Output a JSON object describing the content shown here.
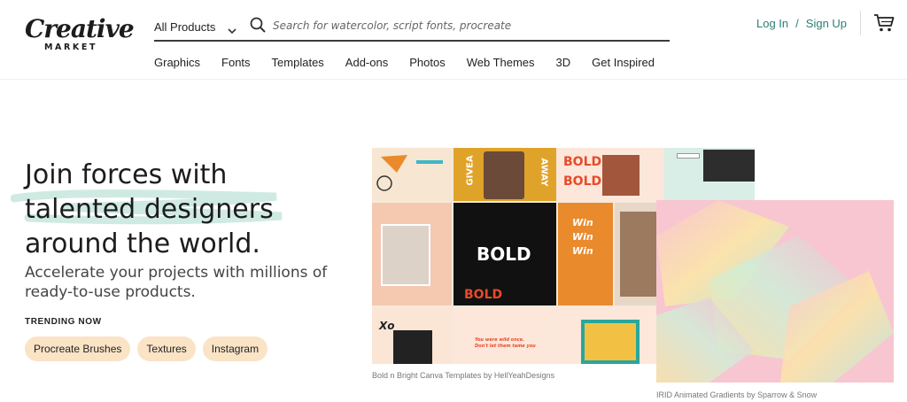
{
  "header": {
    "logo_word": "Creative",
    "logo_sub": "MARKET",
    "product_select": "All Products",
    "search_placeholder": "Search for watercolor, script fonts, procreate",
    "login": "Log In",
    "separator": "/",
    "signup": "Sign Up",
    "nav": [
      "Graphics",
      "Fonts",
      "Templates",
      "Add-ons",
      "Photos",
      "Web Themes",
      "3D",
      "Get Inspired"
    ]
  },
  "hero": {
    "title": "Join forces with talented designers around the world.",
    "subtitle": "Accelerate your projects with millions of ready-to-use products.",
    "trending_label": "TRENDING NOW",
    "trending": [
      "Procreate Brushes",
      "Textures",
      "Instagram"
    ]
  },
  "collage": {
    "caption_left": "Bold n Bright Canva Templates by HellYeahDesigns",
    "caption_right": "IRID Animated Gradients by Sparrow & Snow",
    "tile_words": {
      "giveaway_left": "GIVEA",
      "giveaway_right": "AWAY",
      "bold": "BOLD",
      "win": "Win",
      "xo": "Xo",
      "wild": "You were wild once. Don't let them tame you"
    }
  },
  "colors": {
    "accent_teal": "#2a7f72",
    "chip_bg": "#fbe3c6",
    "bold_red": "#e84a2a",
    "mustard": "#e0a329"
  },
  "icons": {
    "chevron": "chevron-down-icon",
    "search": "search-icon",
    "cart": "cart-icon"
  }
}
